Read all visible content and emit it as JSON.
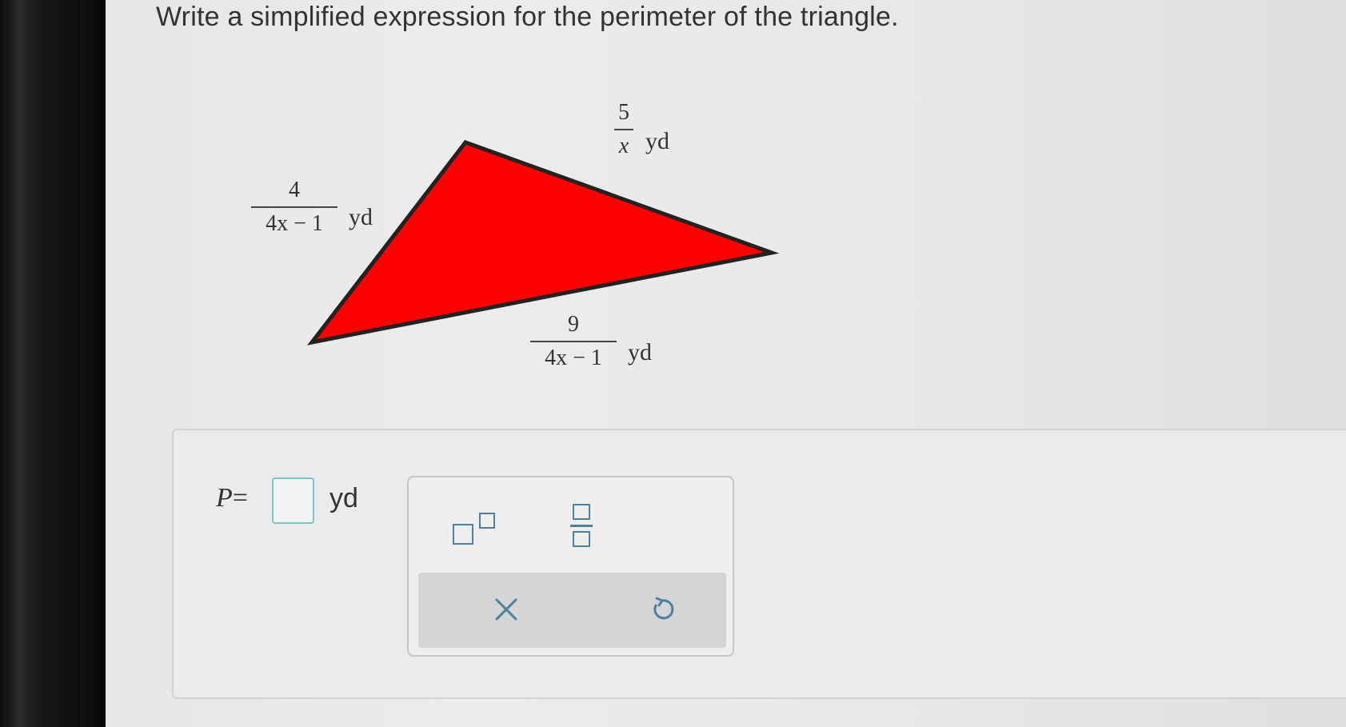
{
  "question": {
    "prompt": "Write a simplified expression for the perimeter of the triangle."
  },
  "figure": {
    "fill_color": "#ff0000",
    "stroke_color": "#222222",
    "sides": [
      {
        "numerator": "4",
        "denominator": "4x − 1",
        "unit": "yd"
      },
      {
        "numerator": "5",
        "denominator": "x",
        "unit": "yd"
      },
      {
        "numerator": "9",
        "denominator": "4x − 1",
        "unit": "yd"
      }
    ]
  },
  "answer": {
    "variable": "P",
    "equals": "=",
    "value": "",
    "unit": "yd"
  },
  "toolbox": {
    "buttons": [
      "exponent-template",
      "fraction-template",
      "clear",
      "undo"
    ],
    "accent_color": "#4d7f9e",
    "input_border_color": "#7fc3c5"
  }
}
